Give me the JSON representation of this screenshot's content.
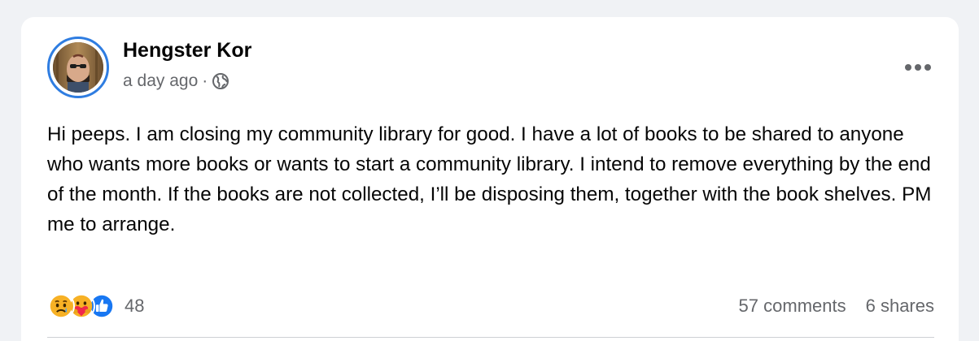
{
  "post": {
    "author": "Hengster Kor",
    "timestamp": "a day ago",
    "separator": "·",
    "privacy_icon": "globe-icon",
    "more_icon": "more-horizontal-icon",
    "text": "Hi peeps. I am closing my community library for good. I have a lot of books to be shared to anyone who wants more books or wants to start a community library. I intend to remove everything by the end of the month. If the books are not collected, I’ll be disposing them, together with the book shelves. PM me to arrange.",
    "reactions": {
      "icons": [
        "sad-reaction-icon",
        "care-reaction-icon",
        "like-reaction-icon"
      ],
      "count": "48"
    },
    "comments_label": "57 comments",
    "shares_label": "6 shares"
  },
  "colors": {
    "avatar_ring": "#2f7de1",
    "secondary_text": "#65676b",
    "like_blue": "#1877f2",
    "reaction_yellow": "#f7b125",
    "page_bg": "#f0f2f5"
  }
}
